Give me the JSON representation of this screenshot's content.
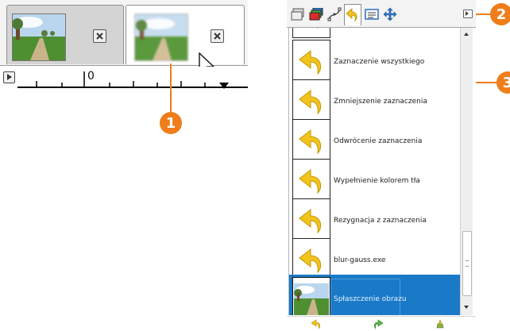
{
  "image_tabs": {
    "tabs": [
      {
        "label": "",
        "active": true
      },
      {
        "label": "",
        "active": false
      }
    ],
    "ruler_zero": "0"
  },
  "callouts": [
    "1",
    "2",
    "3"
  ],
  "dock": {
    "tabs": [
      "layers-icon",
      "channels-icon",
      "paths-icon",
      "undo-history-icon",
      "brushes-icon",
      "move-icon"
    ],
    "history": [
      {
        "label": "",
        "thumb": "undo-arrow-icon"
      },
      {
        "label": "Zaznaczenie wszystkiego",
        "thumb": "undo-arrow-icon"
      },
      {
        "label": "Zmniejszenie zaznaczenia",
        "thumb": "undo-arrow-icon"
      },
      {
        "label": "Odwrócenie zaznaczenia",
        "thumb": "undo-arrow-icon"
      },
      {
        "label": "Wypełnienie kolorem tła",
        "thumb": "undo-arrow-icon"
      },
      {
        "label": "Rezygnacja z zaznaczenia",
        "thumb": "undo-arrow-icon"
      },
      {
        "label": "blur-gauss.exe",
        "thumb": "undo-arrow-icon"
      },
      {
        "label": "Spłaszczenie obrazu",
        "thumb": "image-thumbnail",
        "selected": true
      }
    ],
    "footer": [
      "undo-icon",
      "redo-icon",
      "clear-history-icon"
    ]
  },
  "colors": {
    "accent_orange": "#ef7d1a",
    "selection_blue": "#1a7ac8",
    "undo_arrow_yellow": "#f2c31d"
  }
}
